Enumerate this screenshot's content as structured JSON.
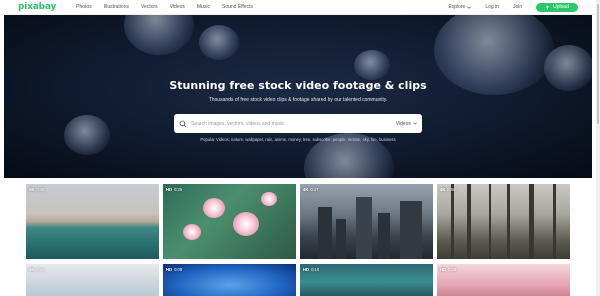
{
  "nav": {
    "logo": "pixabay",
    "links": [
      "Photos",
      "Illustrations",
      "Vectors",
      "Videos",
      "Music",
      "Sound Effects"
    ],
    "explore": "Explore",
    "login": "Log in",
    "join": "Join",
    "upload": "Upload"
  },
  "hero": {
    "title": "Stunning free stock video footage & clips",
    "subtitle": "Thousands of free stock video clips & footage shared by our talented community.",
    "search_placeholder": "Search images, vectors, videos and music",
    "search_type": "Videos",
    "tags": [
      "Popular Videos:",
      "nature,",
      "wallpaper,",
      "rain,",
      "anime,",
      "money,",
      "tree,",
      "subscribe,",
      "people,",
      "motion,",
      "sky,",
      "fire,",
      "business"
    ]
  },
  "videos": [
    {
      "quality": "4K",
      "duration": "0:36"
    },
    {
      "quality": "HD",
      "duration": "0:25"
    },
    {
      "quality": "4K",
      "duration": "0:17"
    },
    {
      "quality": "4K",
      "duration": "0:59"
    },
    {
      "quality": "4K",
      "duration": "0:14"
    },
    {
      "quality": "HD",
      "duration": "0:09"
    },
    {
      "quality": "HD",
      "duration": "0:10"
    },
    {
      "quality": "HD",
      "duration": "0:25"
    }
  ],
  "colors": {
    "brand": "#2ec66d",
    "hero_bg": "#0f1a2e"
  },
  "icons": {
    "search": "search-icon",
    "explore_dropdown": "chevron-down-icon",
    "search_type_dropdown": "chevron-down-icon",
    "upload": "upload-icon"
  }
}
